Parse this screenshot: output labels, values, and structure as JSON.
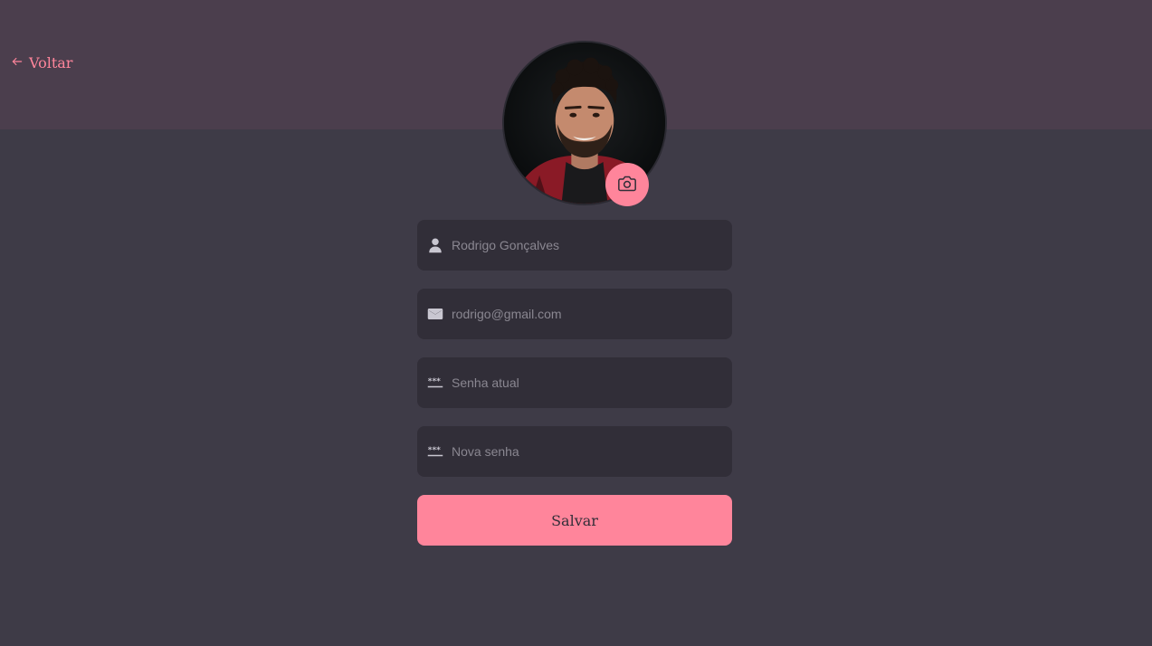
{
  "header": {
    "back_label": "Voltar"
  },
  "profile": {
    "avatar_alt": "Foto de perfil",
    "camera_icon": "camera-icon"
  },
  "form": {
    "name": {
      "value": "",
      "placeholder": "Rodrigo Gonçalves",
      "icon": "user-icon"
    },
    "email": {
      "value": "",
      "placeholder": "rodrigo@gmail.com",
      "icon": "mail-icon"
    },
    "current_password": {
      "value": "",
      "placeholder": "Senha atual",
      "icon": "password-icon"
    },
    "new_password": {
      "value": "",
      "placeholder": "Nova senha",
      "icon": "password-icon"
    },
    "save_label": "Salvar"
  },
  "colors": {
    "background": "#3e3b47",
    "header": "#4b3e4d",
    "accent": "#ff859b",
    "input_bg": "#312e38",
    "icon": "#c9c7d1"
  }
}
